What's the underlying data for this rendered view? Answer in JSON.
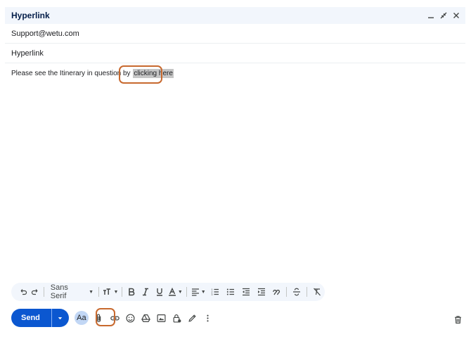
{
  "window": {
    "title": "Hyperlink",
    "controls": [
      "minimize-icon",
      "exit-fullscreen-icon",
      "close-icon"
    ]
  },
  "fields": {
    "to": "Support@wetu.com",
    "subject": "Hyperlink"
  },
  "body": {
    "text_before_link": "Please see the Itinerary in question by ",
    "link_text": "clicking here"
  },
  "formatting_toolbar": {
    "font_family": "Sans Serif",
    "buttons": [
      "undo-icon",
      "redo-icon",
      "font-size-icon",
      "bold-icon",
      "italic-icon",
      "underline-icon",
      "text-color-icon",
      "align-icon",
      "numbered-list-icon",
      "bulleted-list-icon",
      "indent-less-icon",
      "indent-more-icon",
      "quote-icon",
      "strikethrough-icon",
      "remove-formatting-icon"
    ]
  },
  "bottom_toolbar": {
    "send_label": "Send",
    "formatting_toggle_label": "Aa",
    "buttons": [
      "attach-icon",
      "insert-link-icon",
      "emoji-icon",
      "drive-icon",
      "photo-icon",
      "confidential-mode-icon",
      "signature-icon",
      "more-options-icon"
    ],
    "discard": "trash-icon"
  },
  "colors": {
    "accent": "#0b57d0",
    "header_bg": "#f2f6fc",
    "highlight_box": "#c8692e",
    "selection": "#c6c6c6"
  }
}
